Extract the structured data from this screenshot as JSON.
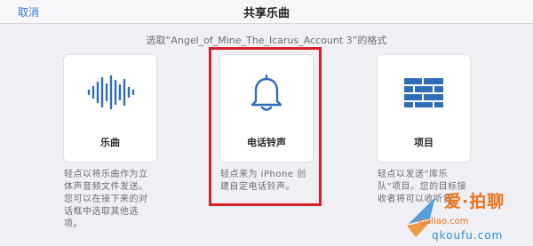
{
  "header": {
    "cancel_label": "取消",
    "title": "共享乐曲"
  },
  "prompt": "选取“Angel_of_Mine_The_Icarus_Account 3”的格式",
  "options": [
    {
      "label": "乐曲",
      "icon": "waveform-icon",
      "description": "轻点以将乐曲作为立体声音频文件发送。您可以在接下来的对话框中选取其他选项。"
    },
    {
      "label": "电话铃声",
      "icon": "bell-icon",
      "description": "轻点来为 iPhone 创建自定电话铃声。",
      "highlighted": true
    },
    {
      "label": "项目",
      "icon": "brick-wall-icon",
      "description": "轻点以发送“库乐队”项目。您的目标接收者将可以收听音。"
    }
  ],
  "watermark": {
    "text": "爱·拍聊",
    "url_small": "igaliao.com",
    "url_large": "qkoufu.com"
  },
  "colors": {
    "accent_blue": "#3478d8",
    "highlight_red": "#d9202a",
    "background": "#efeff4"
  }
}
